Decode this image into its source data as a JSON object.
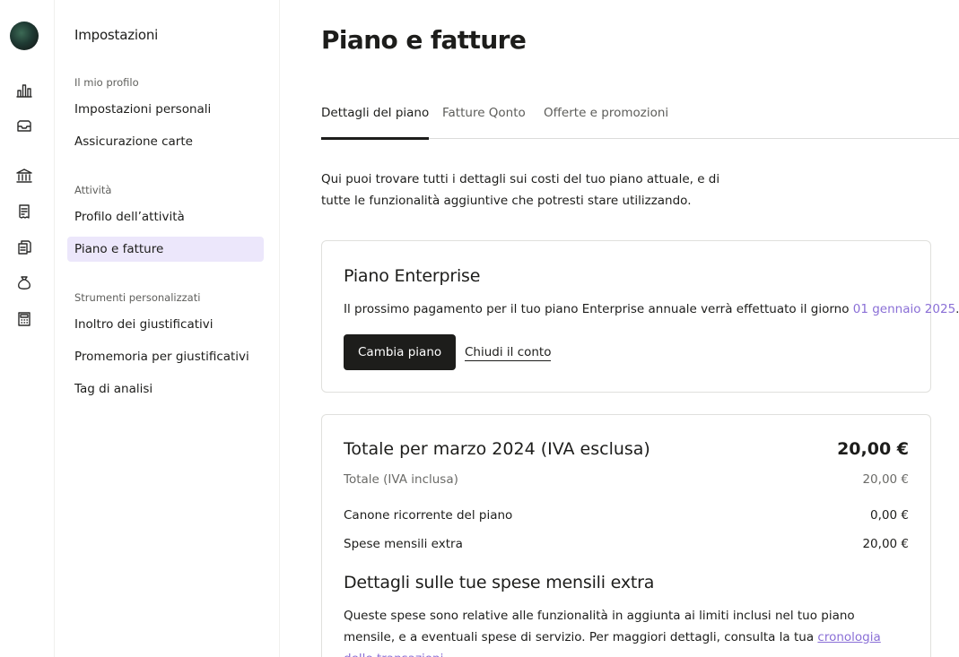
{
  "rail": {
    "icons": [
      "avatar",
      "chart-icon",
      "inbox-icon",
      "bank-icon",
      "receipt-icon",
      "documents-icon",
      "money-bag-icon",
      "calculator-icon"
    ]
  },
  "sidebar": {
    "title": "Impostazioni",
    "sections": [
      {
        "label": "Il mio profilo",
        "items": [
          "Impostazioni personali",
          "Assicurazione carte"
        ]
      },
      {
        "label": "Attività",
        "items": [
          "Profilo dell’attività",
          "Piano e fatture"
        ]
      },
      {
        "label": "Strumenti personalizzati",
        "items": [
          "Inoltro dei giustificativi",
          "Promemoria per giustificativi",
          "Tag di analisi"
        ]
      }
    ],
    "active_item": "Piano e fatture"
  },
  "main": {
    "title": "Piano e fatture",
    "tabs": [
      "Dettagli del piano",
      "Fatture Qonto",
      "Offerte e promozioni"
    ],
    "active_tab": "Dettagli del piano",
    "intro": "Qui puoi trovare tutti i dettagli sui costi del tuo piano attuale, e di tutte le funzionalità aggiuntive che potresti stare utilizzando.",
    "plan_card": {
      "title": "Piano Enterprise",
      "text_before": "Il prossimo pagamento per il tuo piano Enterprise annuale verrà effettuato il giorno ",
      "date": "01 gennaio 2025",
      "text_after": ".",
      "primary_button": "Cambia piano",
      "secondary_link": "Chiudi il conto"
    },
    "total_card": {
      "total_label": "Totale per marzo 2024 (IVA esclusa)",
      "total_value": "20,00 €",
      "vat_label": "Totale (IVA inclusa)",
      "vat_value": "20,00 €",
      "line_items": [
        {
          "label": "Canone ricorrente del piano",
          "value": "0,00 €"
        },
        {
          "label": "Spese mensili extra",
          "value": "20,00 €"
        }
      ],
      "details_title": "Dettagli sulle tue spese mensili extra",
      "details_text": "Queste spese sono relative alle funzionalità in aggiunta ai limiti inclusi nel tuo piano mensile, e a eventuali spese di servizio. Per maggiori dettagli, consulta la tua ",
      "details_link": "cronologia delle transazioni."
    }
  },
  "colors": {
    "accent": "#8a6fd6",
    "active_bg": "#ece7fb",
    "dark": "#1d1d1b"
  }
}
